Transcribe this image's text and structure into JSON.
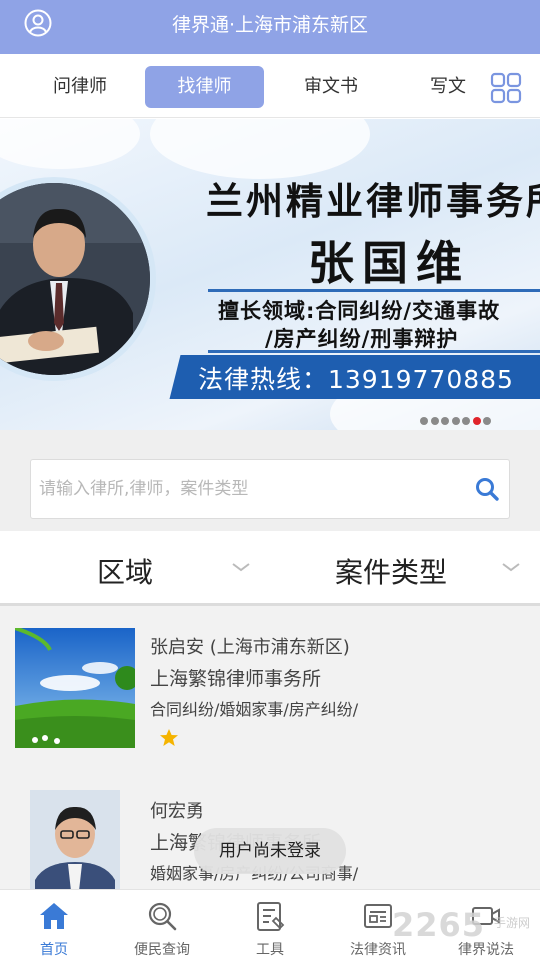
{
  "header": {
    "title": "律界通·上海市浦东新区",
    "avatar_icon": "user-circle-icon"
  },
  "tabs": [
    {
      "label": "问律师",
      "active": false
    },
    {
      "label": "找律师",
      "active": true
    },
    {
      "label": "审文书",
      "active": false
    },
    {
      "label": "写文",
      "active": false
    }
  ],
  "tabs_more_icon": "grid-icon",
  "banner": {
    "firm": "兰州精业律师事务所",
    "lawyer": "张国维",
    "specialty_line1": "擅长领域:合同纠纷/交通事故",
    "specialty_line2": "/房产纠纷/刑事辩护",
    "hotline": "法律热线：13919770885",
    "slide_count": 7,
    "active_slide": 6
  },
  "search": {
    "placeholder": "请输入律所,律师，案件类型",
    "value": ""
  },
  "filters": [
    {
      "label": "区域"
    },
    {
      "label": "案件类型"
    }
  ],
  "lawyers": [
    {
      "name": "张启安 (上海市浦东新区)",
      "firm": "上海繁锦律师事务所",
      "tags": "合同纠纷/婚姻家事/房产纠纷/",
      "stars": 1
    },
    {
      "name": "何宏勇",
      "firm": "上海繁锦律师事务所",
      "tags": "婚姻家事/房产纠纷/公司商事/"
    }
  ],
  "toast": "用户尚未登录",
  "bottom_nav": [
    {
      "label": "首页",
      "icon": "home-icon",
      "active": true
    },
    {
      "label": "便民查询",
      "icon": "search-icon",
      "active": false
    },
    {
      "label": "工具",
      "icon": "tools-icon",
      "active": false
    },
    {
      "label": "法律资讯",
      "icon": "news-icon",
      "active": false
    },
    {
      "label": "律界说法",
      "icon": "video-icon",
      "active": false
    }
  ],
  "watermark": {
    "logo": "2265",
    "sub": "手游网"
  },
  "colors": {
    "header_bg": "#8fa3e6",
    "active_tab_bg": "#8fa3e6",
    "nav_active": "#3a7ad6",
    "star": "#f5b400",
    "dot_active": "#e0242b"
  }
}
